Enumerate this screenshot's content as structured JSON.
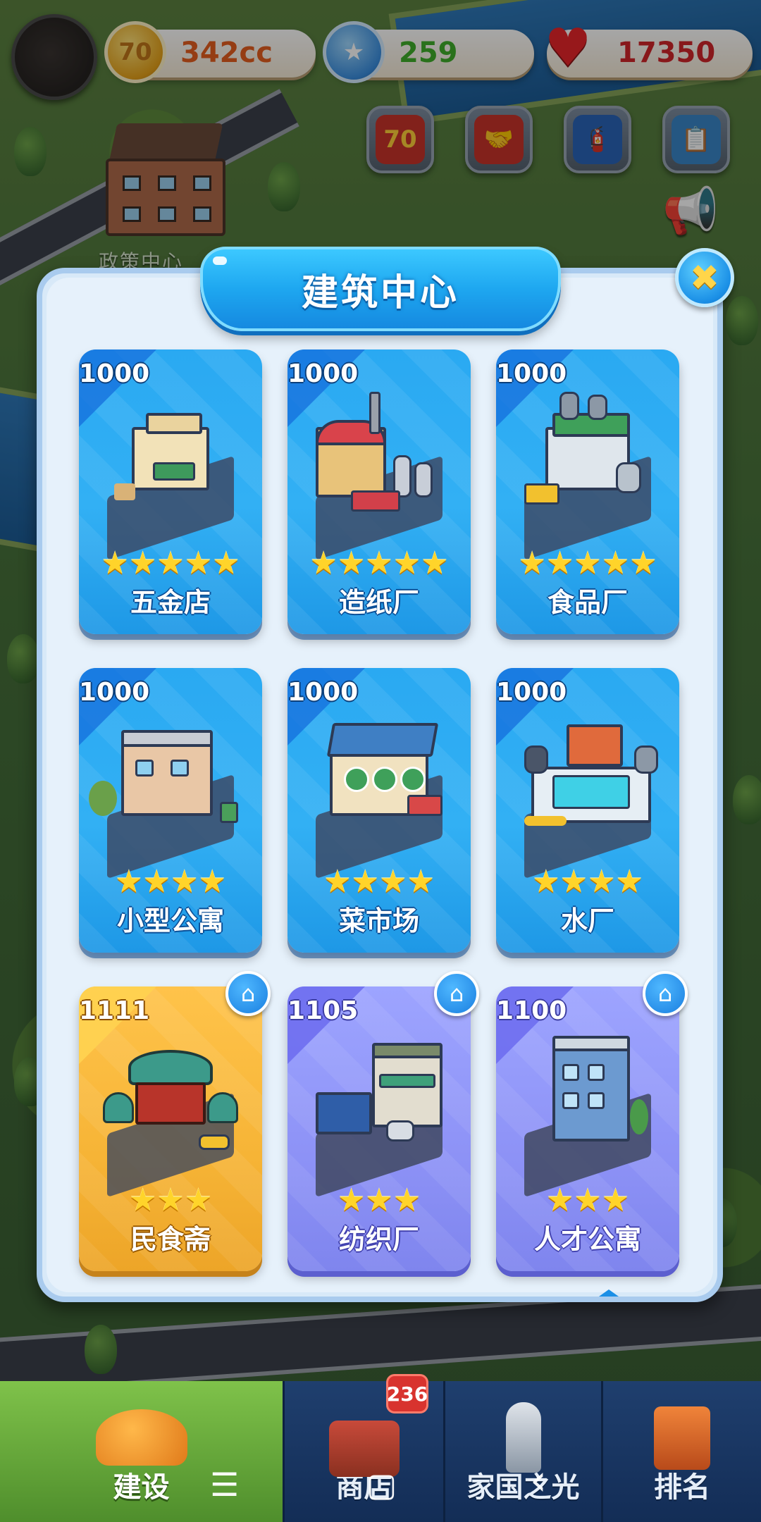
{
  "bg_label": "政策中心",
  "resources": {
    "coins": "342cc",
    "coin_icon_text": "70",
    "stars": "259",
    "hearts": "17350"
  },
  "actions": [
    {
      "name": "70-event",
      "glyph": "70"
    },
    {
      "name": "handshake",
      "glyph": "🤝"
    },
    {
      "name": "fire-safety",
      "glyph": "🧯"
    },
    {
      "name": "clipboard",
      "glyph": "📋"
    }
  ],
  "dialog": {
    "title": "建筑中心",
    "close_glyph": "✖"
  },
  "buildings": [
    {
      "price": "1000",
      "name": "五金店",
      "stars": "★★★★★",
      "color": "blue"
    },
    {
      "price": "1000",
      "name": "造纸厂",
      "stars": "★★★★★",
      "color": "blue"
    },
    {
      "price": "1000",
      "name": "食品厂",
      "stars": "★★★★★",
      "color": "blue"
    },
    {
      "price": "1000",
      "name": "小型公寓",
      "stars": "★★★★",
      "color": "blue"
    },
    {
      "price": "1000",
      "name": "菜市场",
      "stars": "★★★★",
      "color": "blue"
    },
    {
      "price": "1000",
      "name": "水厂",
      "stars": "★★★★",
      "color": "blue"
    },
    {
      "price": "1111",
      "name": "民食斋",
      "stars": "★★★",
      "color": "gold",
      "home": true
    },
    {
      "price": "1105",
      "name": "纺织厂",
      "stars": "★★★",
      "color": "purple",
      "home": true
    },
    {
      "price": "1100",
      "name": "人才公寓",
      "stars": "★★★",
      "color": "purple",
      "home": true
    }
  ],
  "tabs": [
    {
      "label": "建设"
    },
    {
      "label": "商店"
    },
    {
      "label": "家国之光"
    },
    {
      "label": "排名"
    }
  ],
  "shop_badge": "236",
  "system_nav": {
    "menu": "☰",
    "home": "▢",
    "back": "‹"
  },
  "colors": {
    "card_blue": "#2aa9f2",
    "card_gold": "#f6b436",
    "card_purple": "#8d92f6",
    "title_banner": "#1ea7f0"
  }
}
